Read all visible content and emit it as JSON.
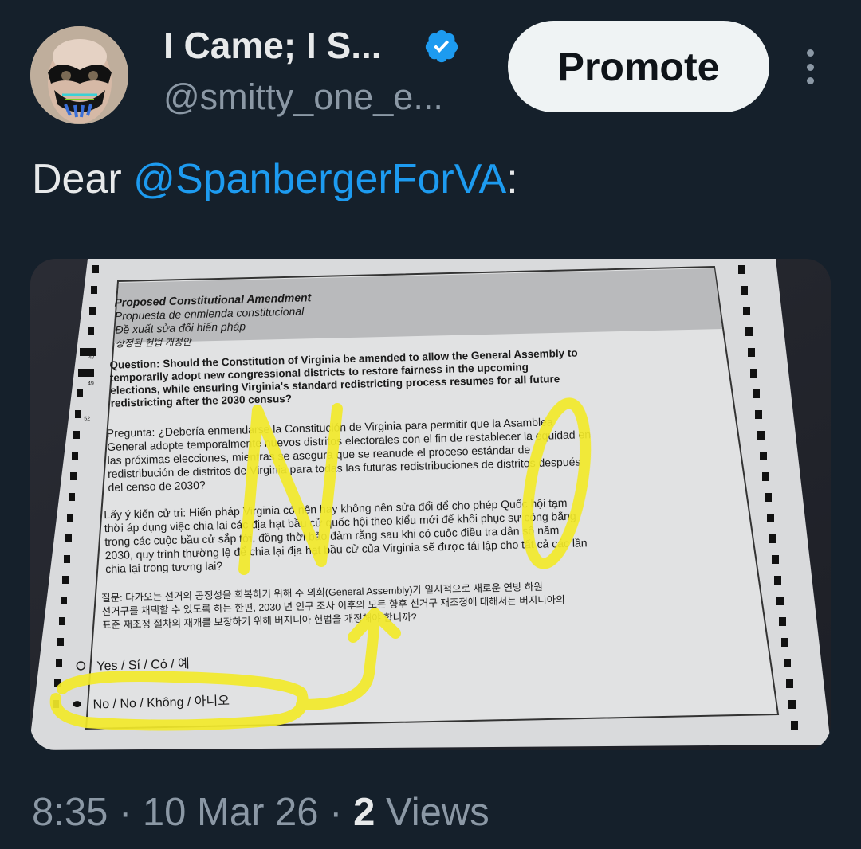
{
  "author": {
    "display_name": "I Came; I S...",
    "handle": "@smitty_one_e...",
    "verified_icon": "verified-badge-icon",
    "avatar": "avatar"
  },
  "actions": {
    "promote_label": "Promote",
    "more_icon": "more-vertical-icon"
  },
  "tweet": {
    "text_prefix": "Dear ",
    "mention": "@SpanbergerForVA",
    "text_suffix": ":"
  },
  "ballot": {
    "header": [
      "Proposed Constitutional Amendment",
      "Propuesta de enmienda constitucional",
      "Đề xuất sửa đổi hiến pháp",
      "상정된 헌법 개정안"
    ],
    "question_en": [
      "Question: Should the Constitution of Virginia be amended to allow the General Assembly to",
      "temporarily adopt new congressional districts to restore fairness in the upcoming",
      "elections, while ensuring Virginia's standard redistricting process resumes for all future",
      "redistricting after the 2030 census?"
    ],
    "question_es": [
      "Pregunta: ¿Debería enmendarse la Constitución de Virginia para permitir que la Asamblea",
      "General adopte temporalmente nuevos distritos electorales con el fin de restablecer la equidad en",
      "las próximas elecciones, mientras se asegura que se reanude el proceso estándar de",
      "redistribución de distritos de Virginia para todas las futuras redistribuciones de distritos después",
      "del censo de 2030?"
    ],
    "question_vi": [
      "Lấy ý kiến cử tri: Hiến pháp Virginia có nên hay không nên sửa đổi để cho phép Quốc hội tạm",
      "thời áp dụng việc chia lại các địa hạt bầu cử quốc hội theo kiểu mới để khôi phục sự công bằng",
      "trong các cuộc bầu cử sắp tới, đồng thời bảo đảm rằng sau khi có cuộc điều tra dân số năm",
      "2030, quy trình thường lệ để chia lại địa hạt bầu cử của Virginia sẽ được tái lập cho tất cả các lần",
      "chia lại trong tương lai?"
    ],
    "question_ko": [
      "질문: 다가오는 선거의 공정성을 회복하기 위해 주 의회(General Assembly)가 일시적으로 새로운 연방 하원",
      "선거구를 채택할 수 있도록 하는 한편, 2030 년 인구 조사 이후의 모든 향후 선거구 재조정에 대해서는 버지니아의",
      "표준 재조정 절차의 재개를 보장하기 위해 버지니아 헌법을 개정해야 합니까?"
    ],
    "option_yes": "Yes / Sí / Có     / 예",
    "option_no": "No / No / Không /  아니오",
    "handwritten": "NO",
    "line_numbers": [
      "47",
      "49",
      "52"
    ]
  },
  "meta": {
    "time": "8:35",
    "sep1": " · ",
    "date": "10 Mar 26",
    "sep2": " · ",
    "views_count": "2",
    "views_label": " Views"
  },
  "colors": {
    "background": "#15202b",
    "accent": "#1d9bf0",
    "highlighter": "#f2ea2a"
  }
}
